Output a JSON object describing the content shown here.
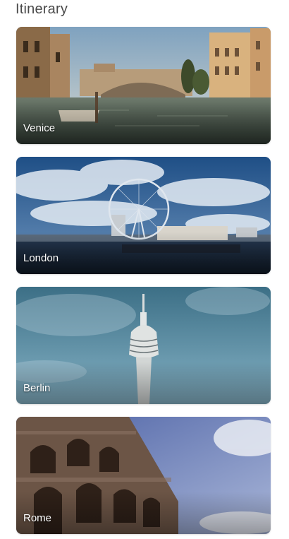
{
  "header": {
    "title": "Itinerary"
  },
  "cards": [
    {
      "city": "Venice",
      "image": "venice-photo"
    },
    {
      "city": "London",
      "image": "london-photo"
    },
    {
      "city": "Berlin",
      "image": "berlin-photo"
    },
    {
      "city": "Rome",
      "image": "rome-photo"
    }
  ]
}
